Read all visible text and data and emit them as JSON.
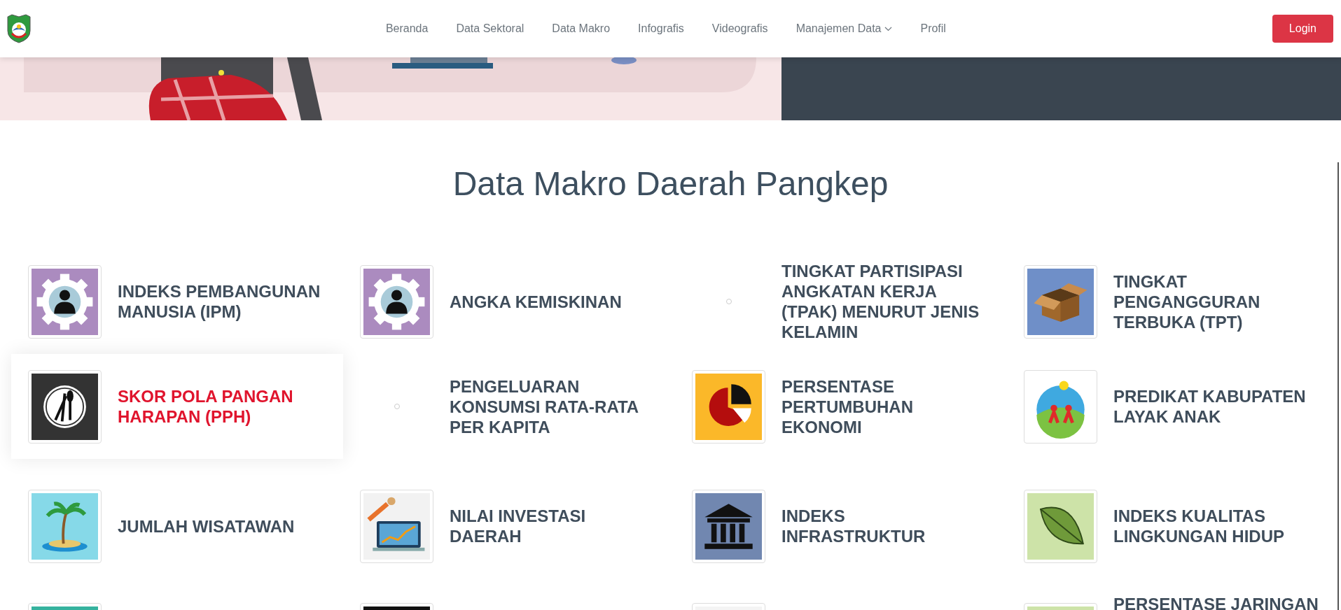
{
  "header": {
    "nav": [
      {
        "label": "Beranda",
        "dropdown": false
      },
      {
        "label": "Data Sektoral",
        "dropdown": false
      },
      {
        "label": "Data Makro",
        "dropdown": false
      },
      {
        "label": "Infografis",
        "dropdown": false
      },
      {
        "label": "Videografis",
        "dropdown": false
      },
      {
        "label": "Manajemen Data",
        "dropdown": true
      },
      {
        "label": "Profil",
        "dropdown": false
      }
    ],
    "login": "Login"
  },
  "section_title": "Data Makro Daerah Pangkep",
  "items": [
    {
      "title": "INDEKS PEMBANGUNAN MANUSIA (IPM)",
      "kind": "gear",
      "selected": false
    },
    {
      "title": "ANGKA KEMISKINAN",
      "kind": "gear",
      "selected": false
    },
    {
      "title": "TINGKAT PARTISIPASI ANGKATAN KERJA (TPAK) MENURUT JENIS KELAMIN",
      "kind": "broken",
      "selected": false
    },
    {
      "title": "TINGKAT PENGANGGURAN TERBUKA (TPT)",
      "kind": "box",
      "selected": false
    },
    {
      "title": "SKOR POLA PANGAN HARAPAN (PPH)",
      "kind": "plate",
      "selected": true
    },
    {
      "title": "PENGELUARAN KONSUMSI RATA-RATA PER KAPITA",
      "kind": "broken",
      "selected": false
    },
    {
      "title": "PERSENTASE PERTUMBUHAN EKONOMI",
      "kind": "pie",
      "selected": false
    },
    {
      "title": "PREDIKAT KABUPATEN LAYAK ANAK",
      "kind": "kla",
      "selected": false
    },
    {
      "title": "JUMLAH WISATAWAN",
      "kind": "island",
      "selected": false
    },
    {
      "title": "NILAI INVESTASI DAERAH",
      "kind": "laptop",
      "selected": false
    },
    {
      "title": "INDEKS INFRASTRUKTUR",
      "kind": "bank",
      "selected": false
    },
    {
      "title": "INDEKS KUALITAS LINGKUNGAN HIDUP",
      "kind": "leaf",
      "selected": false
    },
    {
      "kind": "teal",
      "selected": false
    },
    {
      "kind": "black",
      "selected": false
    },
    {
      "kind": "checker",
      "selected": false
    },
    {
      "title": "PERSENTASE JARINGAN",
      "kind": "lime",
      "selected": false
    }
  ]
}
